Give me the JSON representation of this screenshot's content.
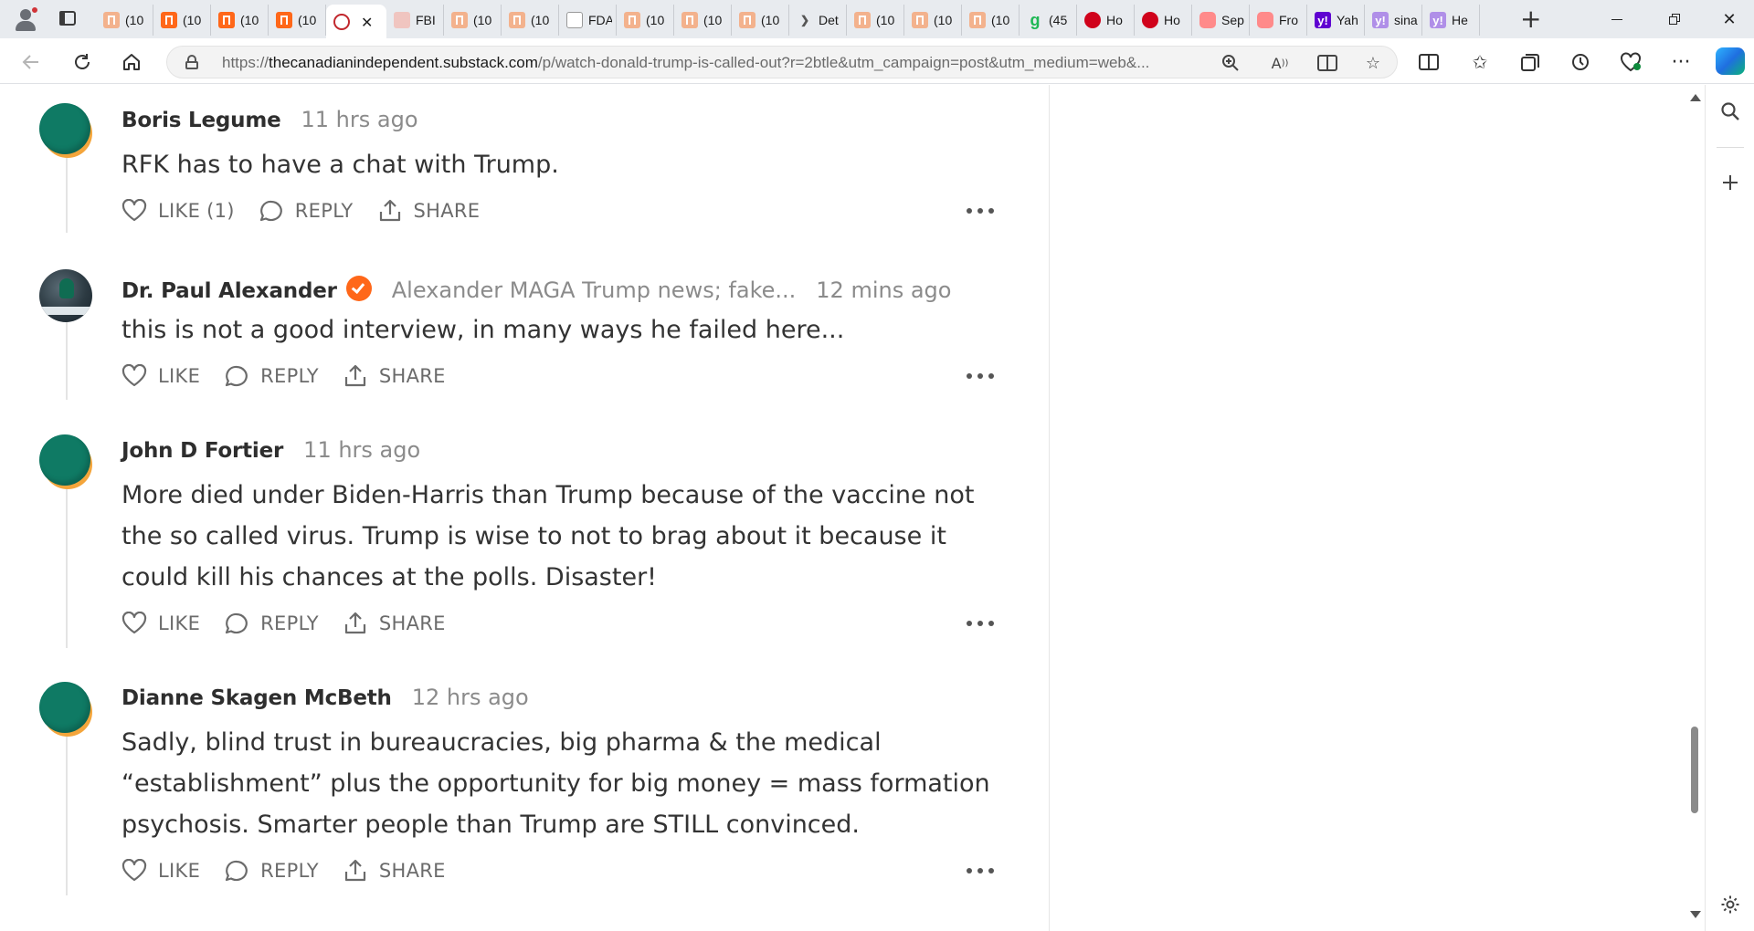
{
  "browser": {
    "tabs": [
      {
        "title": "(10",
        "icon": "substack-icon",
        "style": "pale"
      },
      {
        "title": "(10",
        "icon": "substack-icon",
        "style": "solid"
      },
      {
        "title": "(10",
        "icon": "substack-icon",
        "style": "solid"
      },
      {
        "title": "(10",
        "icon": "substack-icon",
        "style": "solid"
      },
      {
        "title": "",
        "icon": "news-globe-icon",
        "style": "active"
      },
      {
        "title": "FBI",
        "icon": "grid-icon",
        "style": "grid"
      },
      {
        "title": "(10",
        "icon": "substack-icon",
        "style": "pale"
      },
      {
        "title": "(10",
        "icon": "substack-icon",
        "style": "pale"
      },
      {
        "title": "FDA",
        "icon": "video-icon",
        "style": "video"
      },
      {
        "title": "(10",
        "icon": "substack-icon",
        "style": "pale"
      },
      {
        "title": "(10",
        "icon": "substack-icon",
        "style": "pale"
      },
      {
        "title": "(10",
        "icon": "substack-icon",
        "style": "pale"
      },
      {
        "title": "Det",
        "icon": "arrow-icon",
        "style": "arrow"
      },
      {
        "title": "(10",
        "icon": "substack-icon",
        "style": "pale"
      },
      {
        "title": "(10",
        "icon": "substack-icon",
        "style": "pale"
      },
      {
        "title": "(10",
        "icon": "substack-icon",
        "style": "pale"
      },
      {
        "title": "(45",
        "icon": "g-icon",
        "style": "g"
      },
      {
        "title": "Ho",
        "icon": "red-badge-icon",
        "style": "red"
      },
      {
        "title": "Ho",
        "icon": "red-badge-icon",
        "style": "red"
      },
      {
        "title": "Sep",
        "icon": "youtube-icon",
        "style": "yt"
      },
      {
        "title": "Fro",
        "icon": "youtube-icon",
        "style": "yt"
      },
      {
        "title": "Yah",
        "icon": "yahoo-icon",
        "style": "yahoo"
      },
      {
        "title": "sina",
        "icon": "yahoo-icon",
        "style": "yahoo-pale"
      },
      {
        "title": "He",
        "icon": "yahoo-icon",
        "style": "yahoo-pale"
      }
    ],
    "url_prefix": "https://",
    "url_host": "thecanadianindependent.substack.com",
    "url_path": "/p/watch-donald-trump-is-called-out?r=2btle&utm_campaign=post&utm_medium=web&...",
    "new_tab_label": "+",
    "close_tab_label": "✕"
  },
  "comments": [
    {
      "author": "Boris Legume",
      "byline": "",
      "verified": false,
      "time": "11 hrs ago",
      "body": "RFK has to have a chat with Trump.",
      "avatar": "default",
      "actions": {
        "like": "LIKE (1)",
        "reply": "REPLY",
        "share": "SHARE"
      }
    },
    {
      "author": "Dr. Paul Alexander",
      "byline": "Alexander MAGA Trump news; fake...",
      "verified": true,
      "time": "12 mins ago",
      "body": "this is not a good interview, in many ways he failed here...",
      "avatar": "photo",
      "actions": {
        "like": "LIKE",
        "reply": "REPLY",
        "share": "SHARE"
      }
    },
    {
      "author": "John D Fortier",
      "byline": "",
      "verified": false,
      "time": "11 hrs ago",
      "body": "More died under Biden-Harris than Trump because of the vaccine not the so called virus. Trump is wise to not to brag about it because it could kill his chances at the polls. Disaster!",
      "avatar": "default",
      "actions": {
        "like": "LIKE",
        "reply": "REPLY",
        "share": "SHARE"
      }
    },
    {
      "author": "Dianne Skagen McBeth",
      "byline": "",
      "verified": false,
      "time": "12 hrs ago",
      "body": "Sadly, blind trust in bureaucracies, big pharma & the medical “establishment” plus the opportunity for big money = mass formation psychosis. Smarter people than Trump are STILL convinced.",
      "avatar": "default",
      "actions": {
        "like": "LIKE",
        "reply": "REPLY",
        "share": "SHARE"
      }
    }
  ],
  "colors": {
    "accent": "#ff6719",
    "avatar_green": "#0f7a64",
    "avatar_orange": "#f4a53b",
    "text": "#333333",
    "muted": "#8b8b8b"
  }
}
